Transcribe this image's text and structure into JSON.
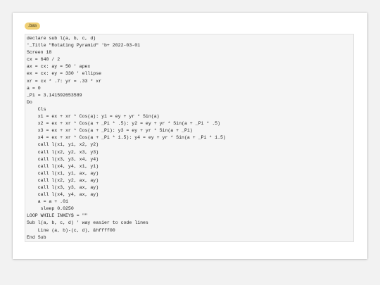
{
  "file_tag": {
    "label": ".bas",
    "color": "#f0cf74"
  },
  "code": {
    "lines": [
      "declare sub l(a, b, c, d)",
      "'_Title \"Rotating Pyramid\" 'b+ 2022-03-01",
      "Screen 18",
      "cx = 640 / 2",
      "ax = cx: ay = 50 ' apex",
      "ex = cx: ey = 330 ' ellipse",
      "xr = cx * .7: yr = .33 * xr",
      "a = 0",
      "_Pi = 3.141592653589",
      "Do",
      "    Cls",
      "    x1 = ex + xr * Cos(a): y1 = ey + yr * Sin(a)",
      "    x2 = ex + xr * Cos(a + _Pi * .5): y2 = ey + yr * Sin(a + _Pi * .5)",
      "    x3 = ex + xr * Cos(a + _Pi): y3 = ey + yr * Sin(a + _Pi)",
      "    x4 = ex + xr * Cos(a + _Pi * 1.5): y4 = ey + yr * Sin(a + _Pi * 1.5)",
      "    call l(x1, y1, x2, y2)",
      "    call l(x2, y2, x3, y3)",
      "    call l(x3, y3, x4, y4)",
      "    call l(x4, y4, x1, y1)",
      "    call l(x1, y1, ax, ay)",
      "    call l(x2, y2, ax, ay)",
      "    call l(x3, y3, ax, ay)",
      "    call l(x4, y4, ax, ay)",
      "    a = a + .01",
      "     sleep 0.0250",
      "LOOP WHILE INKEY$ = \"\"",
      "Sub l(a, b, c, d) ' way easier to code lines",
      "    Line (a, b)-(c, d), &hffff00",
      "End Sub"
    ]
  }
}
